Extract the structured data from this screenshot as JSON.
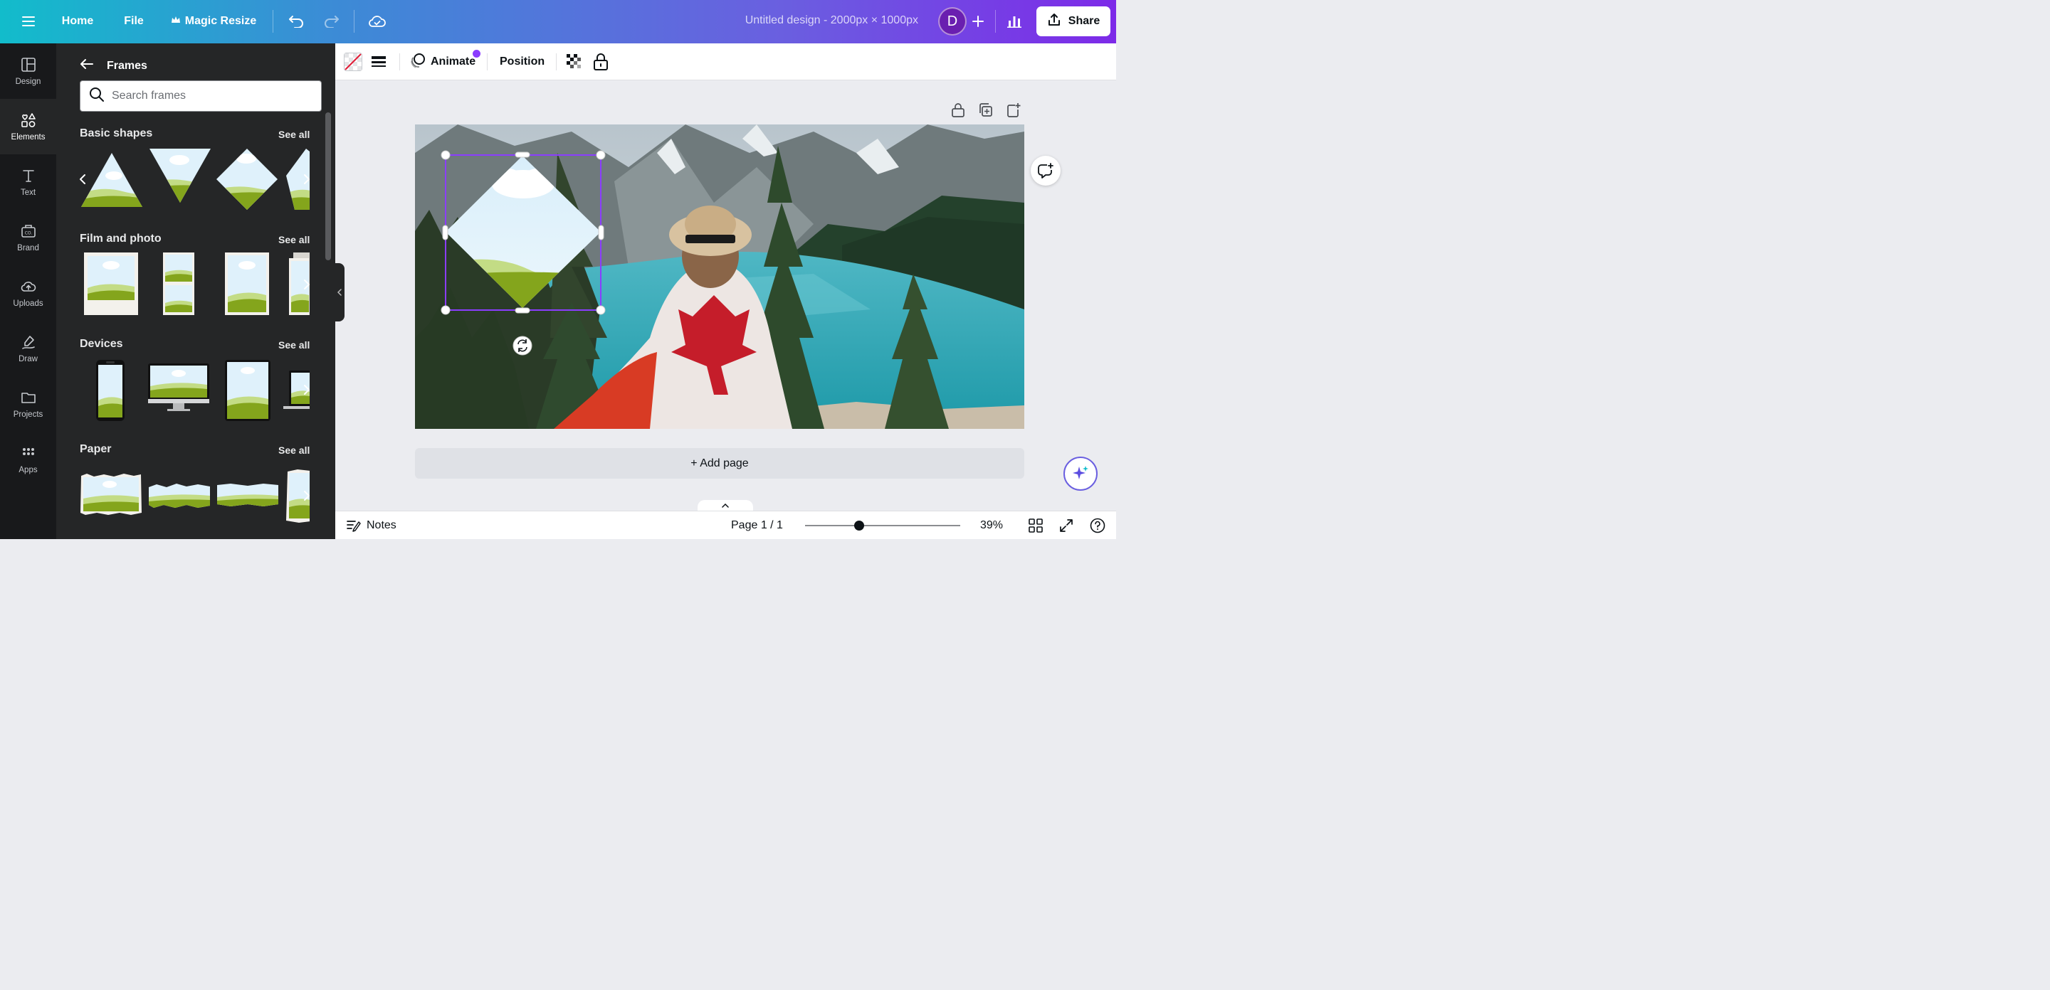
{
  "topbar": {
    "home_label": "Home",
    "file_label": "File",
    "magic_resize_label": "Magic Resize",
    "doc_title": "Untitled design - 2000px × 1000px",
    "avatar_initial": "D",
    "share_label": "Share"
  },
  "rail": {
    "items": [
      {
        "label": "Design"
      },
      {
        "label": "Elements"
      },
      {
        "label": "Text"
      },
      {
        "label": "Brand"
      },
      {
        "label": "Uploads"
      },
      {
        "label": "Draw"
      },
      {
        "label": "Projects"
      },
      {
        "label": "Apps"
      }
    ]
  },
  "panel": {
    "title": "Frames",
    "search_placeholder": "Search frames",
    "sections": [
      {
        "title": "Basic shapes",
        "see_all": "See all"
      },
      {
        "title": "Film and photo",
        "see_all": "See all"
      },
      {
        "title": "Devices",
        "see_all": "See all"
      },
      {
        "title": "Paper",
        "see_all": "See all"
      }
    ]
  },
  "context_toolbar": {
    "animate_label": "Animate",
    "position_label": "Position"
  },
  "canvas": {
    "add_page_label": "+ Add page"
  },
  "bottombar": {
    "notes_label": "Notes",
    "page_indicator": "Page 1 / 1",
    "zoom_level": "39%",
    "zoom_fraction": 0.35
  },
  "colors": {
    "accent": "#7d2ae8",
    "selection": "#8b3dff",
    "panel_bg": "#252627",
    "rail_bg": "#18191b"
  }
}
